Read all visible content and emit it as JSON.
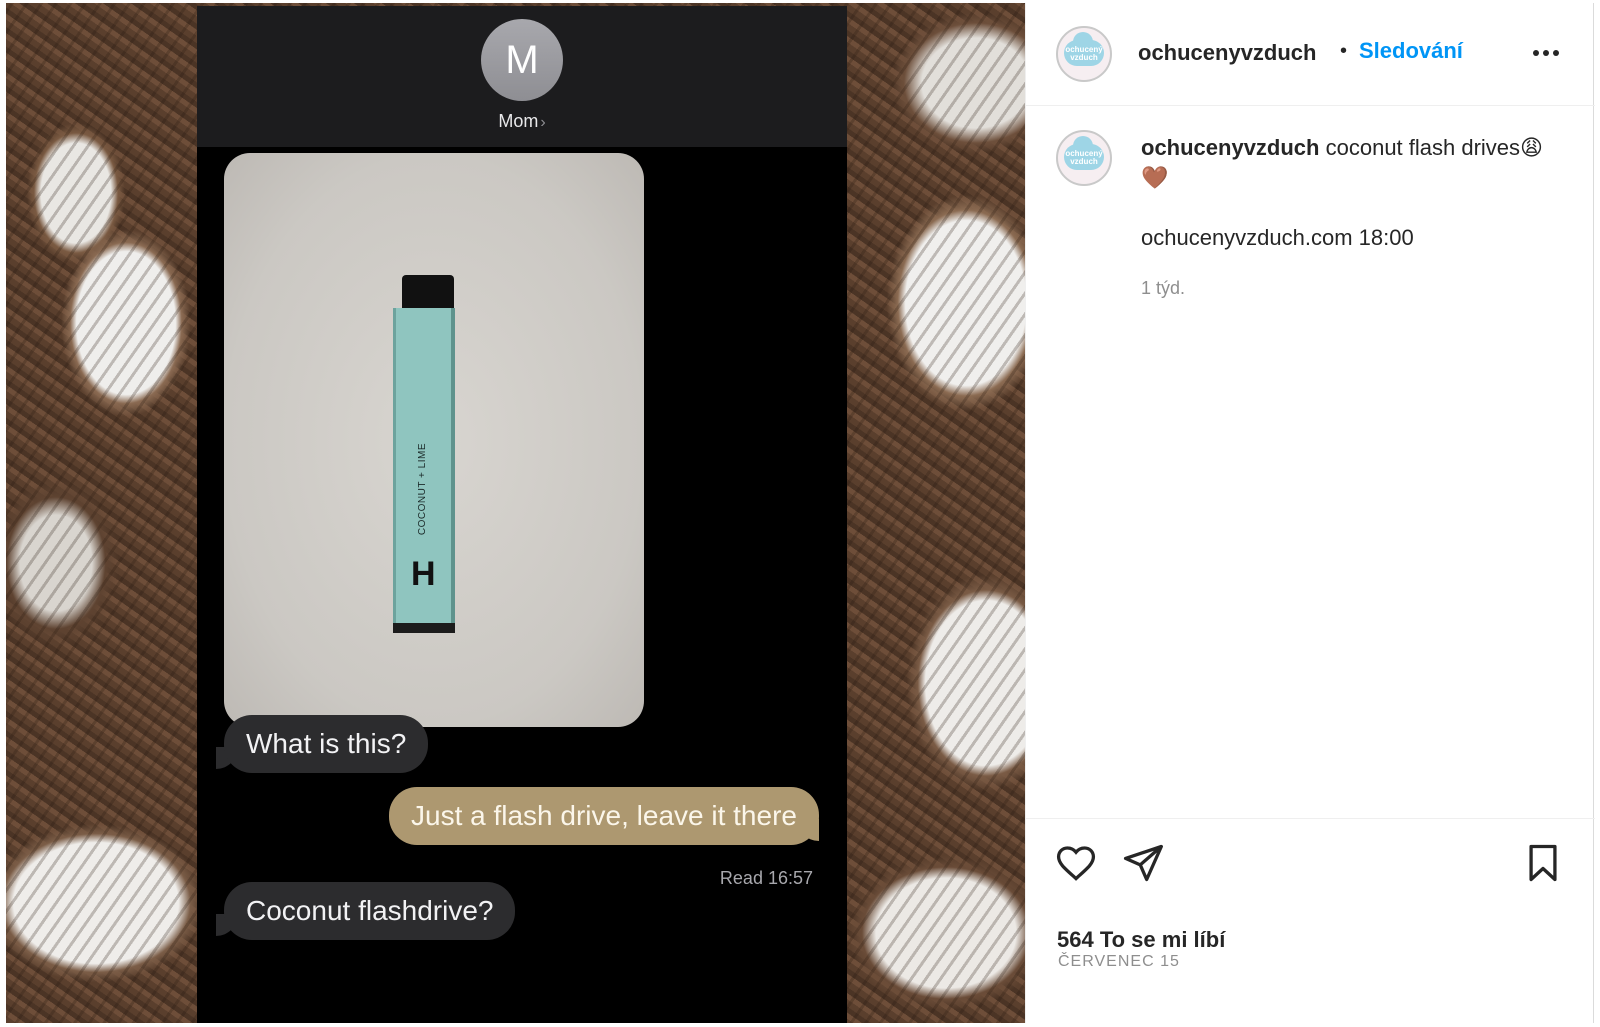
{
  "conversation": {
    "contact_initial": "M",
    "contact_name": "Mom",
    "contact_chevron": "›",
    "photo_label": "COCONUT + LIME",
    "photo_logo": "H",
    "messages": [
      {
        "side": "in",
        "text": "What is this?"
      },
      {
        "side": "out",
        "text": "Just a flash drive, leave it there"
      },
      {
        "side": "in",
        "text": "Coconut flashdrive?"
      }
    ],
    "read_receipt": "Read 16:57"
  },
  "post": {
    "username": "ochucenyvzduch",
    "dot": "•",
    "follow_label": "Sledování",
    "avatar_text_line1": "ochucený",
    "avatar_text_line2": "vzduch",
    "caption_user": "ochucenyvzduch",
    "caption_text": "coconut flash drives😩🤎",
    "caption_link": "ochucenyvzduch.com 18:00",
    "caption_time": "1 týd.",
    "likes": "564 To se mi líbí",
    "date": "ČERVENEC 15"
  },
  "icons": {
    "more": "more-horizontal-icon",
    "like": "heart-icon",
    "share": "paper-plane-icon",
    "save": "bookmark-icon"
  },
  "colors": {
    "follow_blue": "#0095f6",
    "bubble_incoming": "#2c2c2e",
    "bubble_outgoing": "#ad9870",
    "usb_teal": "#8fc5bf"
  }
}
